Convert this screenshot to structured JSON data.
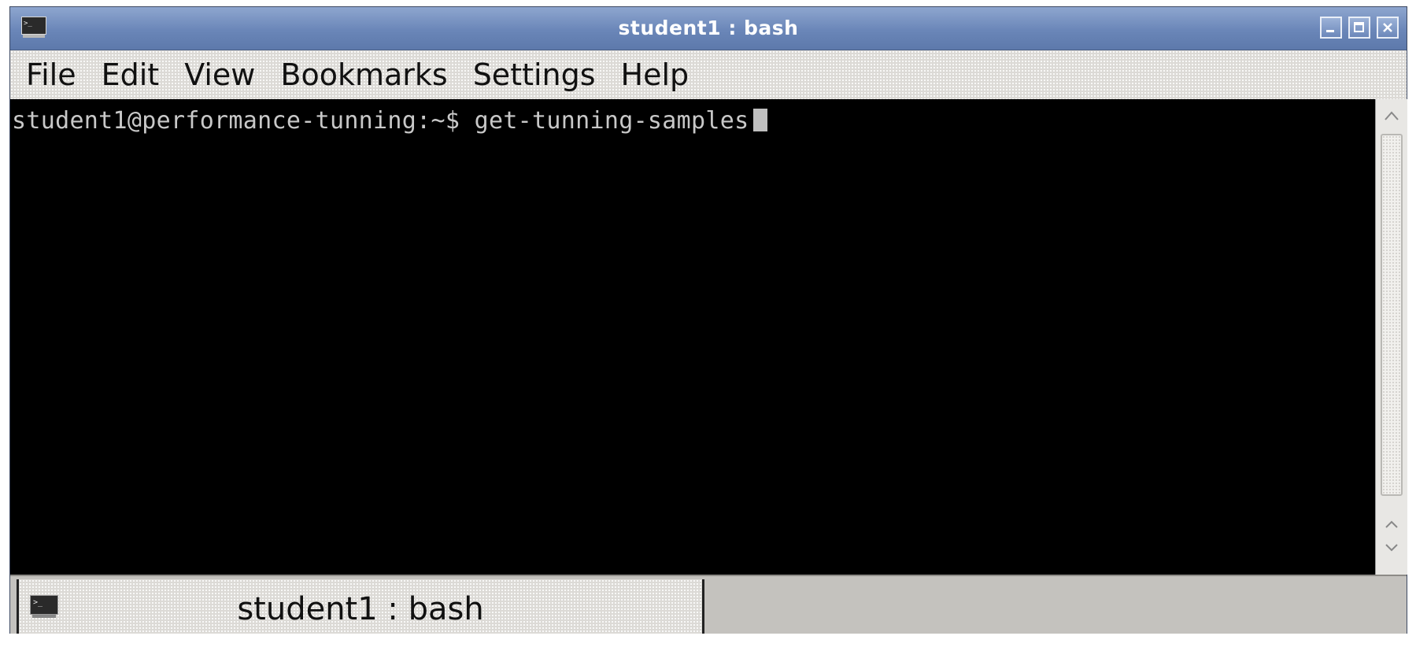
{
  "window": {
    "title": "student1 : bash",
    "controls": [
      "minimize-icon",
      "maximize-icon",
      "close-icon"
    ]
  },
  "menubar": {
    "items": [
      {
        "label": "File"
      },
      {
        "label": "Edit"
      },
      {
        "label": "View"
      },
      {
        "label": "Bookmarks"
      },
      {
        "label": "Settings"
      },
      {
        "label": "Help"
      }
    ]
  },
  "terminal": {
    "prompt": "student1@performance-tunning:~$",
    "command": "get-tunning-samples"
  },
  "tabs": [
    {
      "label": "student1 : bash",
      "icon": "terminal-icon"
    }
  ],
  "colors": {
    "titlebar": "#6a86b8",
    "terminal_bg": "#000000",
    "terminal_fg": "#c8c8c8"
  }
}
